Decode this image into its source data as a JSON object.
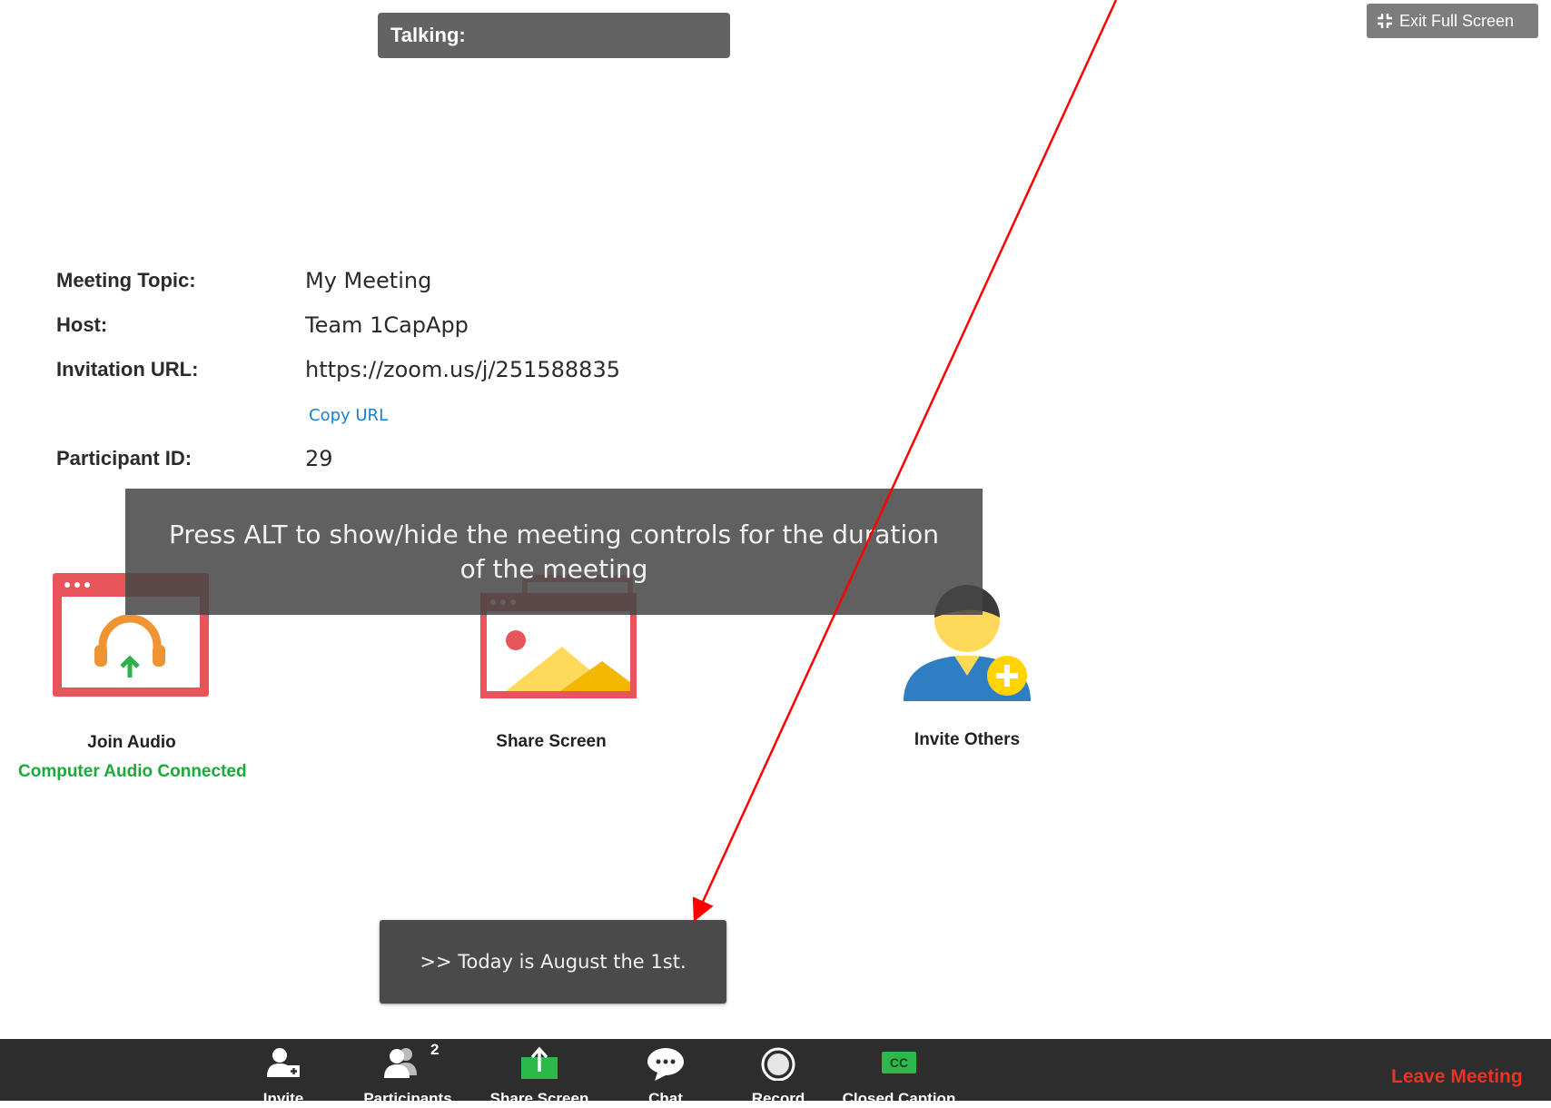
{
  "talking": {
    "label": "Talking:"
  },
  "exit_fullscreen": {
    "label": "Exit Full Screen"
  },
  "meeting_info": {
    "topic_label": "Meeting Topic:",
    "topic_value": "My Meeting",
    "host_label": "Host:",
    "host_value": "Team 1CapApp",
    "url_label": "Invitation URL:",
    "url_value": "https://zoom.us/j/251588835",
    "copy_url": "Copy URL",
    "participant_label": "Participant ID:",
    "participant_value": "29"
  },
  "overlay": {
    "line1": "Press ALT to show/hide the meeting controls for the duration",
    "line2": "of the meeting"
  },
  "tiles": {
    "join_audio": "Join Audio",
    "audio_status": "Computer Audio Connected",
    "share_screen": "Share Screen",
    "invite_others": "Invite Others"
  },
  "caption": {
    "text": ">> Today is August the 1st."
  },
  "toolbar": {
    "invite": "Invite",
    "participants": "Participants",
    "participants_count": "2",
    "share_screen": "Share Screen",
    "chat": "Chat",
    "record": "Record",
    "closed_caption": "Closed Caption",
    "cc_badge": "CC",
    "leave": "Leave Meeting"
  },
  "colors": {
    "audio_connected": "#1aaa3a",
    "leave": "#ea3323",
    "annotation_arrow": "#ff0000",
    "toolbar_bg": "#2d2d2d"
  }
}
